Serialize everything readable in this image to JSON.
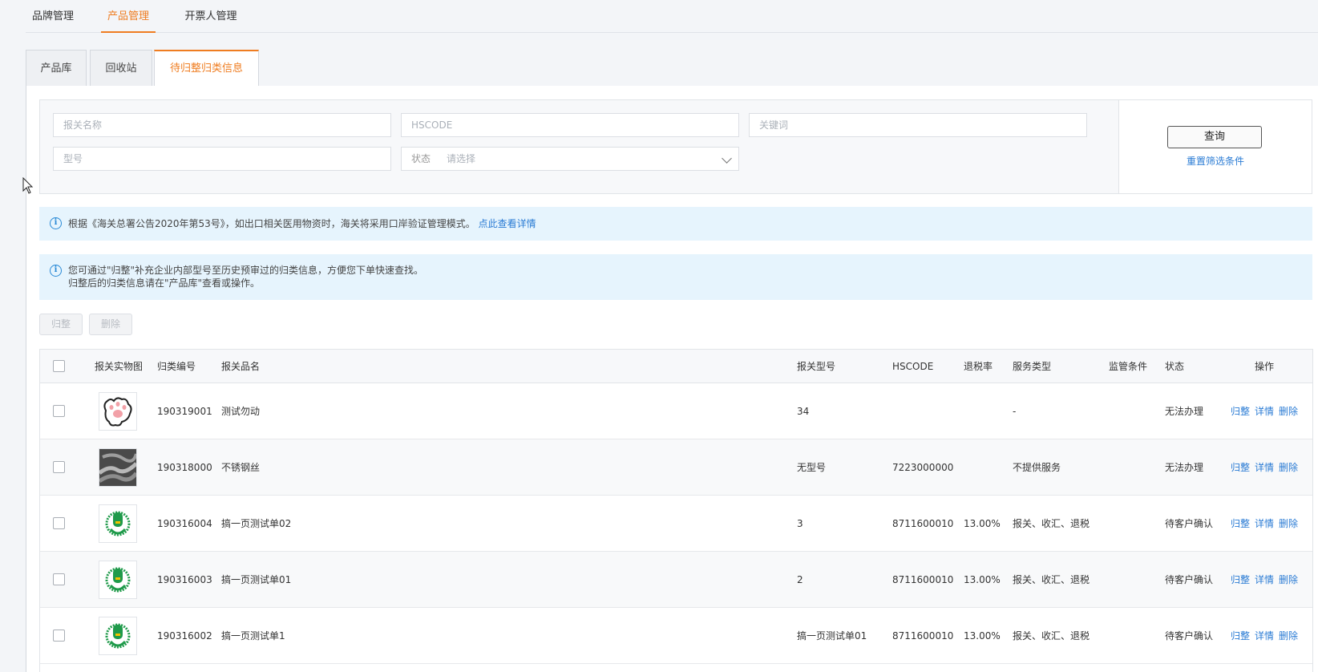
{
  "topnav": {
    "items": [
      "品牌管理",
      "产品管理",
      "开票人管理"
    ],
    "active": 1
  },
  "subtabs": {
    "items": [
      "产品库",
      "回收站",
      "待归整归类信息"
    ],
    "active": 2
  },
  "filter": {
    "customs_name_placeholder": "报关名称",
    "hscode_placeholder": "HSCODE",
    "keyword_placeholder": "关键词",
    "model_placeholder": "型号",
    "status_label": "状态",
    "status_value": "请选择",
    "query_label": "查询",
    "reset_label": "重置筛选条件"
  },
  "notice1": {
    "text": "根据《海关总署公告2020年第53号》，如出口相关医用物资时，海关将采用口岸验证管理模式。",
    "link": "点此查看详情"
  },
  "notice2": {
    "line1": "您可通过\"归整\"补充企业内部型号至历史预审过的归类信息，方便您下单快速查找。",
    "line2": "归整后的归类信息请在\"产品库\"查看或操作。"
  },
  "actions": {
    "organize": "归整",
    "delete": "删除"
  },
  "table": {
    "headers": [
      "报关实物图",
      "归类编号",
      "报关品名",
      "报关型号",
      "HSCODE",
      "退税率",
      "服务类型",
      "监管条件",
      "状态",
      "操作"
    ],
    "row_ops": [
      "归整",
      "详情",
      "删除"
    ],
    "rows": [
      {
        "image": "paw-icon",
        "code": "190319001",
        "name": "测试勿动",
        "model": "34",
        "hscode": "",
        "rate": "",
        "service": "-",
        "supervision": "",
        "status": "无法办理"
      },
      {
        "image": "steel-wire-photo",
        "code": "190318000",
        "name": "不锈钢丝",
        "model": "无型号",
        "hscode": "7223000000",
        "rate": "",
        "service": "不提供服务",
        "supervision": "",
        "status": "无法办理"
      },
      {
        "image": "green-logo",
        "code": "190316004",
        "name": "搞一页测试单02",
        "model": "3",
        "hscode": "8711600010",
        "rate": "13.00%",
        "service": "报关、收汇、退税",
        "supervision": "",
        "status": "待客户确认"
      },
      {
        "image": "green-logo",
        "code": "190316003",
        "name": "搞一页测试单01",
        "model": "2",
        "hscode": "8711600010",
        "rate": "13.00%",
        "service": "报关、收汇、退税",
        "supervision": "",
        "status": "待客户确认"
      },
      {
        "image": "green-logo",
        "code": "190316002",
        "name": "搞一页测试单1",
        "model": "搞一页测试单01",
        "hscode": "8711600010",
        "rate": "13.00%",
        "service": "报关、收汇、退税",
        "supervision": "",
        "status": "待客户确认"
      }
    ]
  },
  "colors": {
    "accent": "#ef7d21",
    "link": "#2a7bd4",
    "info_bg": "#e6f4fd"
  }
}
